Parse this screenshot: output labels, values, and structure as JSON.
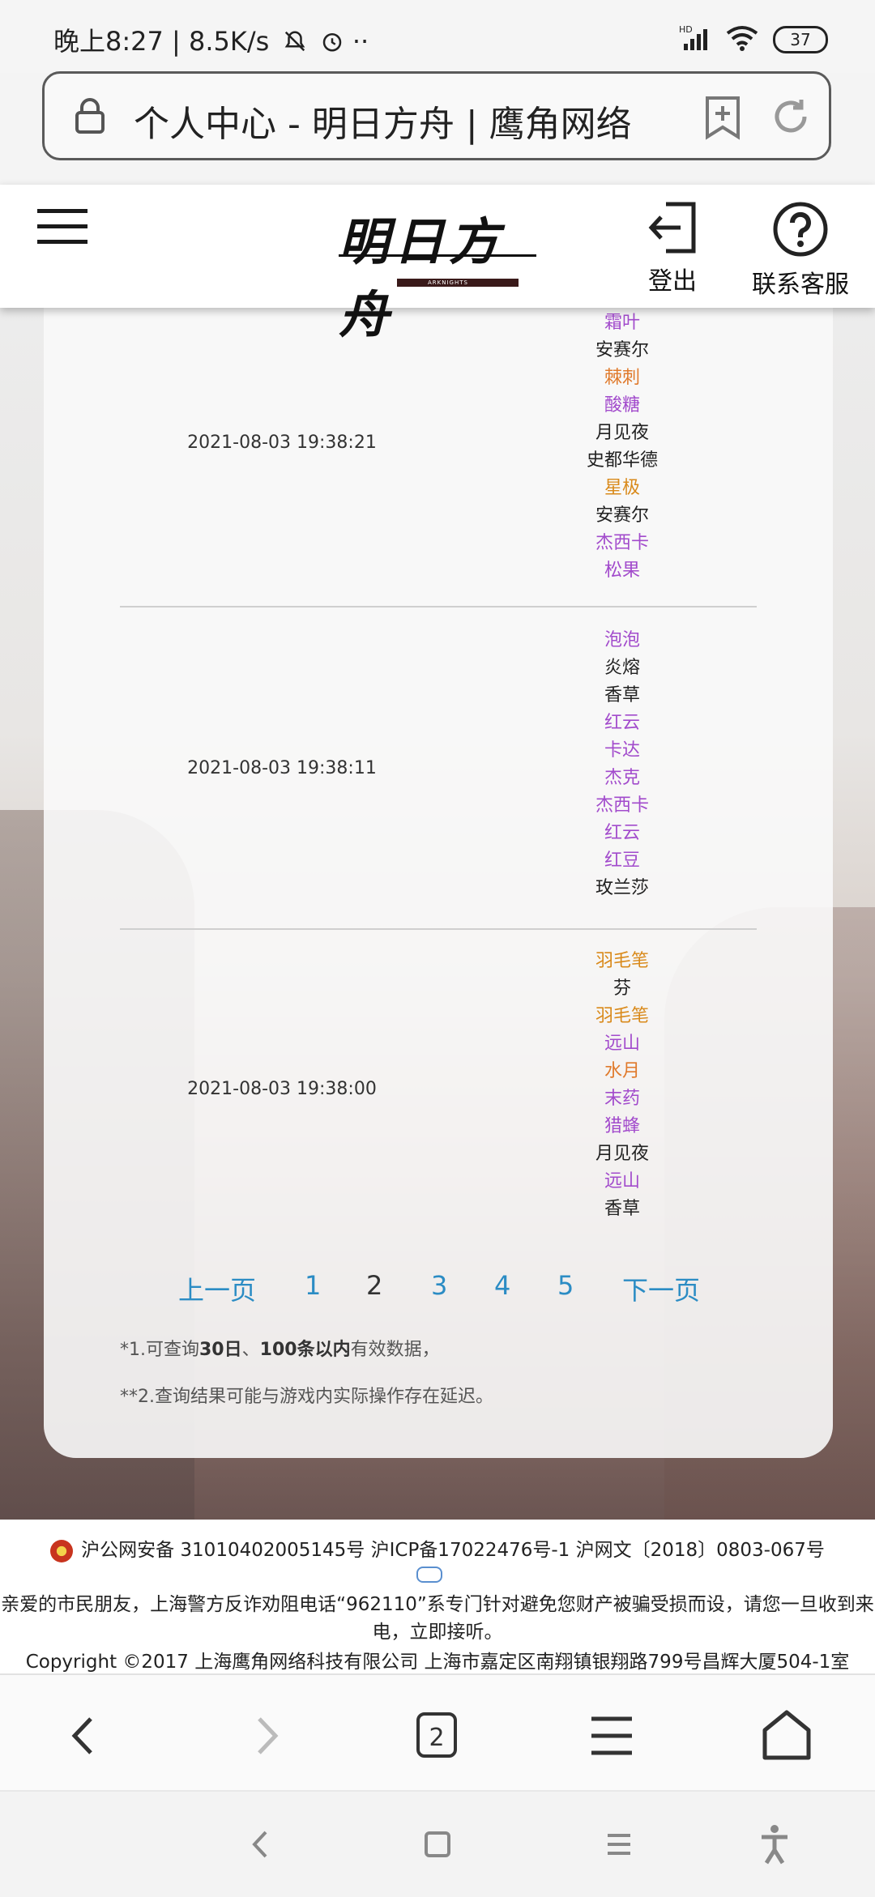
{
  "status_bar": {
    "time": "晚上8:27",
    "speed": "8.5K/s",
    "extra": "··",
    "network": "HD",
    "battery": "37"
  },
  "url_bar": {
    "title": "个人中心 - 明日方舟 | 鹰角网络"
  },
  "header": {
    "logo_text": "明日方舟",
    "logo_subtext": "ARKNIGHTS",
    "logout_label": "登出",
    "service_label": "联系客服"
  },
  "colors": {
    "purple": "#a24bcc",
    "orange": "#d98a1b",
    "orange_deep": "#e07a2c",
    "black": "#222222",
    "link_blue": "#2b8cc4"
  },
  "records": [
    {
      "time": "2021-08-03 19:38:21",
      "operators": [
        {
          "name": "霜叶",
          "rarity": "purple"
        },
        {
          "name": "安赛尔",
          "rarity": "black"
        },
        {
          "name": "棘刺",
          "rarity": "orange_deep"
        },
        {
          "name": "酸糖",
          "rarity": "purple"
        },
        {
          "name": "月见夜",
          "rarity": "black"
        },
        {
          "name": "史都华德",
          "rarity": "black"
        },
        {
          "name": "星极",
          "rarity": "orange"
        },
        {
          "name": "安赛尔",
          "rarity": "black"
        },
        {
          "name": "杰西卡",
          "rarity": "purple"
        },
        {
          "name": "松果",
          "rarity": "purple"
        }
      ]
    },
    {
      "time": "2021-08-03 19:38:11",
      "operators": [
        {
          "name": "泡泡",
          "rarity": "purple"
        },
        {
          "name": "炎熔",
          "rarity": "black"
        },
        {
          "name": "香草",
          "rarity": "black"
        },
        {
          "name": "红云",
          "rarity": "purple"
        },
        {
          "name": "卡达",
          "rarity": "purple"
        },
        {
          "name": "杰克",
          "rarity": "purple"
        },
        {
          "name": "杰西卡",
          "rarity": "purple"
        },
        {
          "name": "红云",
          "rarity": "purple"
        },
        {
          "name": "红豆",
          "rarity": "purple"
        },
        {
          "name": "玫兰莎",
          "rarity": "black"
        }
      ]
    },
    {
      "time": "2021-08-03 19:38:00",
      "operators": [
        {
          "name": "羽毛笔",
          "rarity": "orange"
        },
        {
          "name": "芬",
          "rarity": "black"
        },
        {
          "name": "羽毛笔",
          "rarity": "orange"
        },
        {
          "name": "远山",
          "rarity": "purple"
        },
        {
          "name": "水月",
          "rarity": "orange_deep"
        },
        {
          "name": "末药",
          "rarity": "purple"
        },
        {
          "name": "猎蜂",
          "rarity": "purple"
        },
        {
          "name": "月见夜",
          "rarity": "black"
        },
        {
          "name": "远山",
          "rarity": "purple"
        },
        {
          "name": "香草",
          "rarity": "black"
        }
      ]
    }
  ],
  "pagination": {
    "prev": "上一页",
    "pages": [
      "1",
      "2",
      "3",
      "4",
      "5"
    ],
    "current": "2",
    "next": "下一页"
  },
  "notes": {
    "n1_prefix": "*1.可查询",
    "n1_b1": "30日",
    "n1_mid": "、",
    "n1_b2": "100条以内",
    "n1_suffix": "有效数据，",
    "n2": "**2.查询结果可能与游戏内实际操作存在延迟。"
  },
  "footer": {
    "line1": "沪公网安备 31010402005145号  沪ICP备17022476号-1  沪网文〔2018〕0803-067号",
    "line2": "亲爱的市民朋友，上海警方反诈劝阻电话“962110”系专门针对避免您财产被骗受损而设，请您一旦收到来电，立即接听。",
    "line3": "Copyright ©2017 上海鹰角网络科技有限公司  上海市嘉定区南翔镇银翔路799号昌辉大厦504-1室"
  },
  "browser_nav": {
    "tab_count": "2",
    "icons": [
      "back-icon",
      "forward-icon",
      "tabs-icon",
      "menu-icon",
      "home-icon"
    ]
  },
  "system_nav": {
    "icons": [
      "back-icon",
      "home-icon",
      "recents-icon",
      "accessibility-icon"
    ]
  }
}
